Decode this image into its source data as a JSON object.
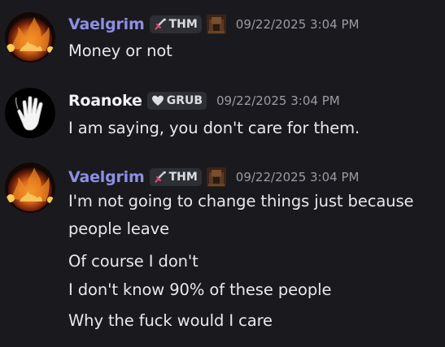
{
  "messages": [
    {
      "author": "Vaelgrim",
      "author_color": "#8f8de6",
      "tag": "THM",
      "tag_icon": "sword-icon",
      "timestamp": "09/22/2025 3:04 PM",
      "lines": [
        "Money or not"
      ]
    },
    {
      "author": "Roanoke",
      "author_color": "#f2f3f5",
      "tag": "GRUB",
      "tag_icon": "heart-icon",
      "timestamp": "09/22/2025 3:04 PM",
      "lines": [
        "I am saying, you don't care for them."
      ]
    },
    {
      "author": "Vaelgrim",
      "author_color": "#8f8de6",
      "tag": "THM",
      "tag_icon": "sword-icon",
      "timestamp": "09/22/2025 3:04 PM",
      "lines": [
        "I'm not going to change things just because",
        "people leave",
        "Of course I don't",
        "I don't know 90% of these people",
        "Why the fuck would I care"
      ]
    }
  ]
}
